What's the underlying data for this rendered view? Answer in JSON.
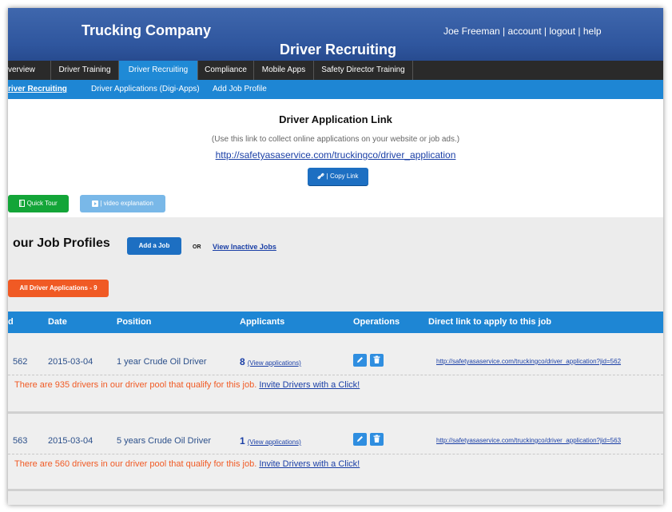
{
  "header": {
    "company": "Trucking Company",
    "subtitle": "Driver Recruiting",
    "user_name": "Joe Freeman",
    "account": "account",
    "logout": "logout",
    "help": "help",
    "separator": "|"
  },
  "nav": {
    "tabs": [
      "verview",
      "Driver Training",
      "Driver Recruiting",
      "Compliance",
      "Mobile Apps",
      "Safety Director Training"
    ],
    "active": "Driver Recruiting"
  },
  "subnav": {
    "items": [
      "river Recruiting",
      "Driver Applications (Digi-Apps)",
      "Add Job Profile"
    ]
  },
  "link_section": {
    "title": "Driver Application Link",
    "hint": "(Use this link to collect online applications on your website or job ads.)",
    "url": "http://safetyasaservice.com/truckingco/driver_application",
    "copy_label": "| Copy Link"
  },
  "buttons": {
    "quick_tour": "Quick Tour",
    "video": "| video explanation"
  },
  "jobs": {
    "title": "our Job Profiles",
    "add_job": "Add a Job",
    "or": "OR",
    "view_inactive": "View Inactive Jobs",
    "all_apps": "All Driver Applications - 9"
  },
  "table": {
    "headers": [
      "d",
      "Date",
      "Position",
      "Applicants",
      "Operations",
      "Direct link to apply to this job"
    ],
    "rows": [
      {
        "id": "562",
        "date": "2015-03-04",
        "position": "1 year Crude Oil Driver",
        "applicants": "8",
        "view": "(View applications)",
        "link": "http://safetyasaservice.com/truckingco/driver_application?jid=562",
        "pool": "There are 935 drivers in our driver pool that qualify for this job.",
        "invite": "Invite Drivers with a Click!"
      },
      {
        "id": "563",
        "date": "2015-03-04",
        "position": "5 years Crude Oil Driver",
        "applicants": "1",
        "view": "(View applications)",
        "link": "http://safetyasaservice.com/truckingco/driver_application?jid=563",
        "pool": "There are 560 drivers in our driver pool that qualify for this job.",
        "invite": "Invite Drivers with a Click!"
      }
    ]
  },
  "colors": {
    "header_blue": "#2f569e",
    "nav_dark": "#2a2a2a",
    "accent_blue": "#1e86d4",
    "button_blue": "#1d6fc2",
    "green": "#13a538",
    "orange": "#f05a24"
  }
}
